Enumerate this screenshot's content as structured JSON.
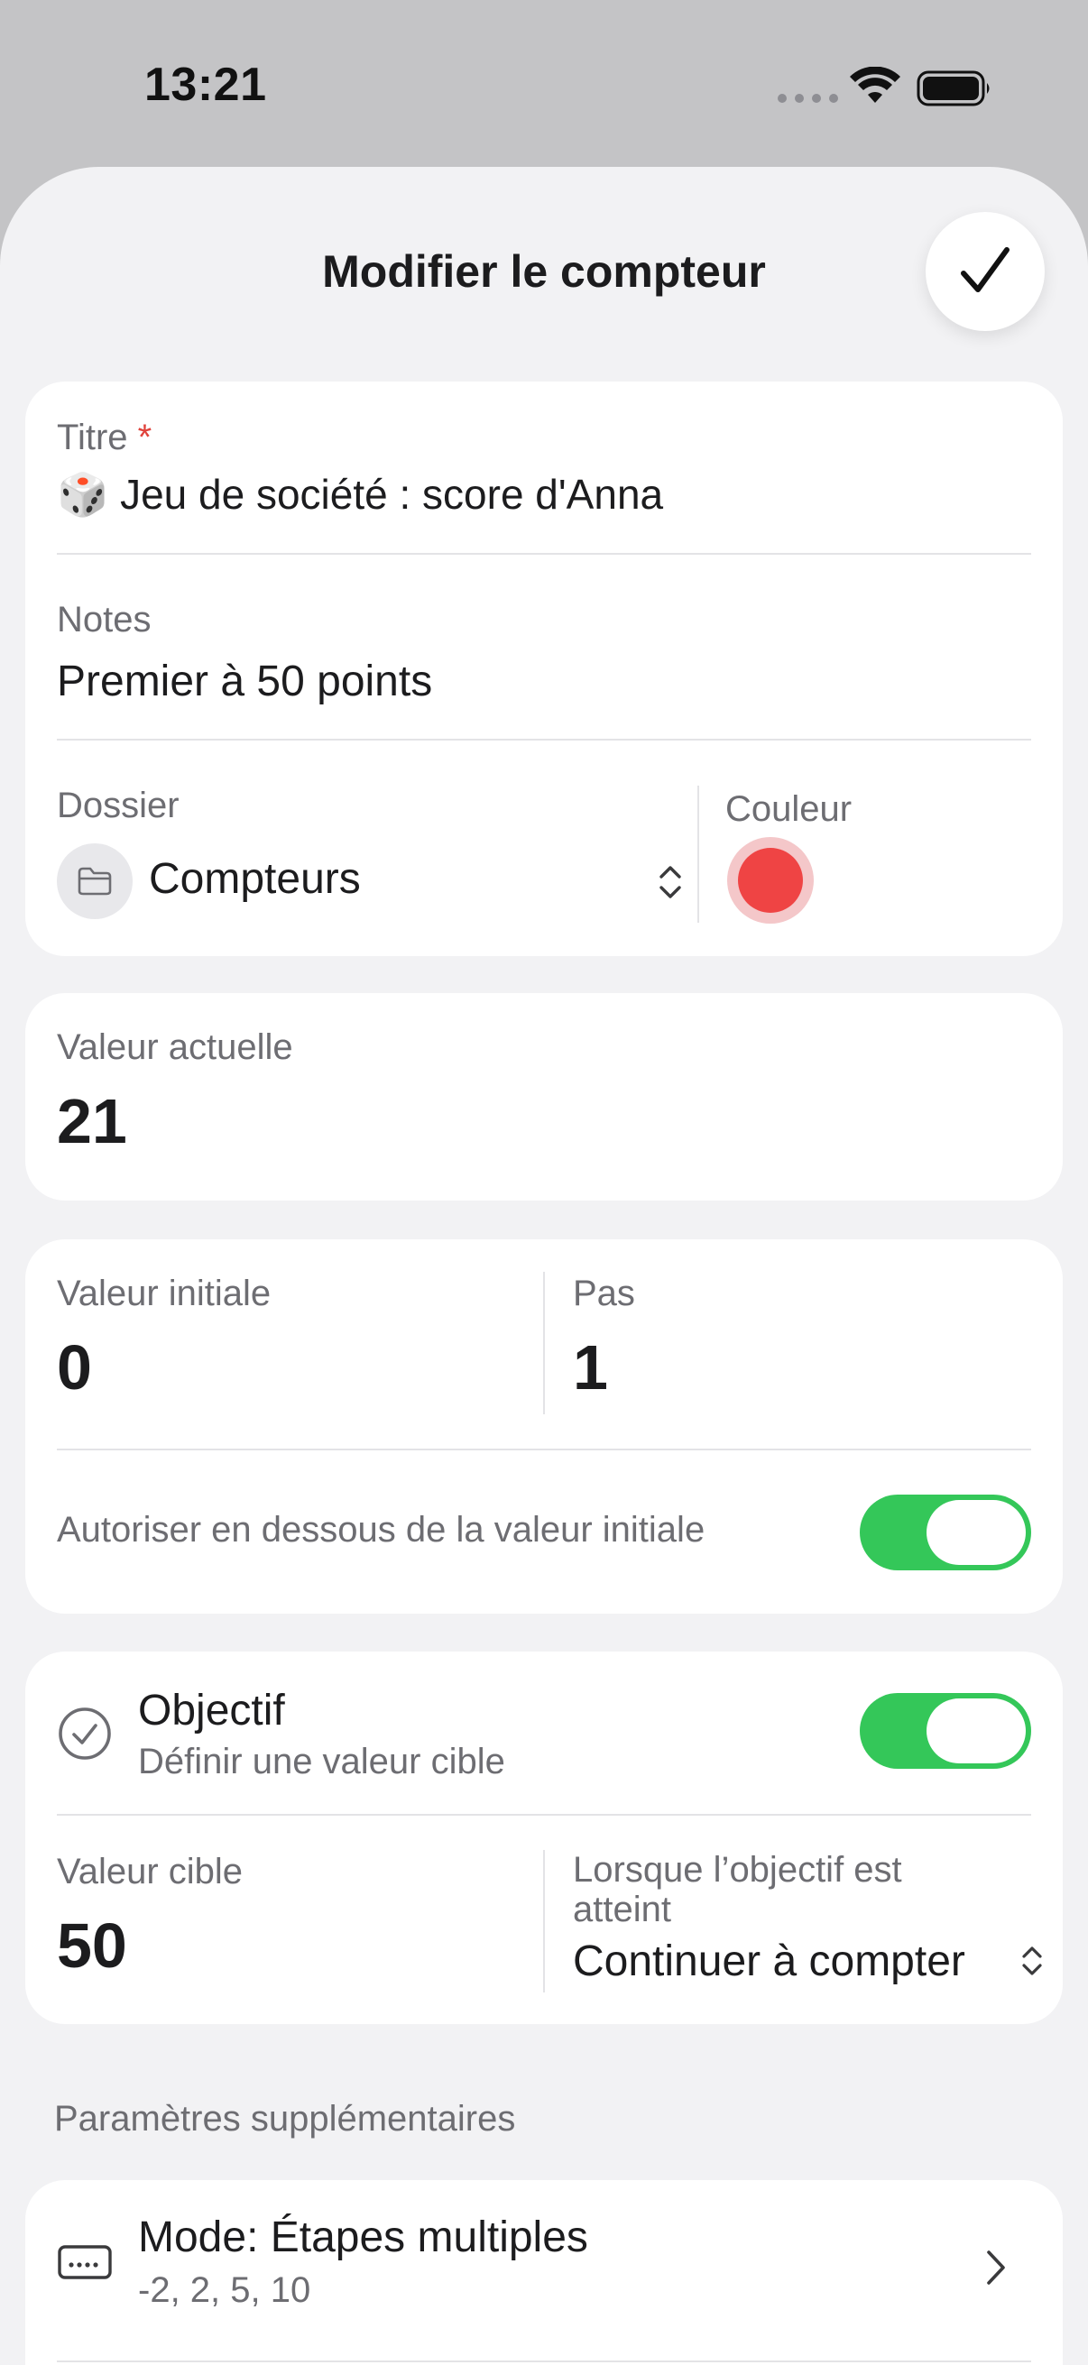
{
  "status_bar": {
    "time": "13:21"
  },
  "sheet": {
    "title": "Modifier le compteur",
    "done_icon": "checkmark-icon"
  },
  "details": {
    "title_label": "Titre",
    "title_required_mark": "*",
    "title_emoji": "🎲",
    "title_value": "Jeu de société : score d'Anna",
    "notes_label": "Notes",
    "notes_value": "Premier à 50 points",
    "folder_label": "Dossier",
    "folder_value": "Compteurs",
    "color_label": "Couleur",
    "color_value": "#ef4444"
  },
  "current": {
    "label": "Valeur actuelle",
    "value": "21"
  },
  "config": {
    "initial_label": "Valeur initiale",
    "initial_value": "0",
    "step_label": "Pas",
    "step_value": "1",
    "allow_below_label": "Autoriser en dessous de la valeur initiale",
    "allow_below_on": true
  },
  "goal": {
    "title": "Objectif",
    "subtitle": "Définir une valeur cible",
    "enabled": true,
    "target_label": "Valeur cible",
    "target_value": "50",
    "when_reached_label": "Lorsque l’objectif est atteint",
    "when_reached_value": "Continuer à compter"
  },
  "extra": {
    "section_title": "Paramètres supplémentaires",
    "mode_title": "Mode: Étapes multiples",
    "mode_subtitle": "-2, 2, 5, 10"
  },
  "colors": {
    "accent_green": "#34c759",
    "required_red": "#e0433c",
    "background": "#f2f2f4"
  }
}
